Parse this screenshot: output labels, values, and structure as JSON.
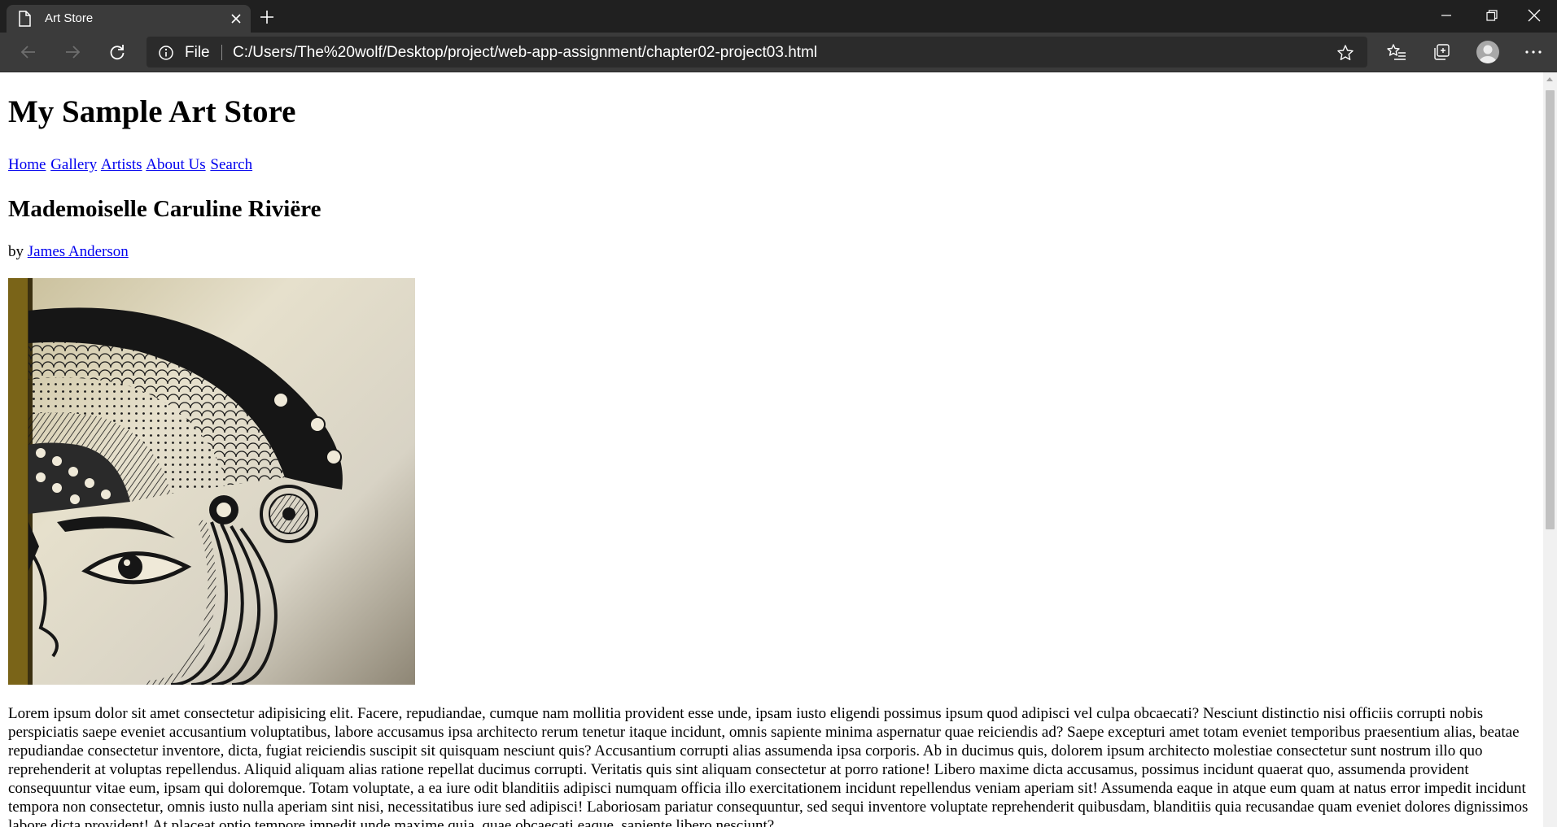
{
  "browser": {
    "tab_title": "Art Store",
    "address_chip": "File",
    "url": "C:/Users/The%20wolf/Desktop/project/web-app-assignment/chapter02-project03.html"
  },
  "page": {
    "site_title": "My Sample Art Store",
    "nav": [
      "Home",
      "Gallery",
      "Artists",
      "About Us",
      "Search"
    ],
    "art_title": "Mademoiselle Caruline Riviëre",
    "by_prefix": "by",
    "artist": "James Anderson",
    "description": "Lorem ipsum dolor sit amet consectetur adipisicing elit. Facere, repudiandae, cumque nam mollitia provident esse unde, ipsam iusto eligendi possimus ipsum quod adipisci vel culpa obcaecati? Nesciunt distinctio nisi officiis corrupti nobis perspiciatis saepe eveniet accusantium voluptatibus, labore accusamus ipsa architecto rerum tenetur itaque incidunt, omnis sapiente minima aspernatur quae reiciendis ad? Saepe excepturi amet totam eveniet temporibus praesentium alias, beatae repudiandae consectetur inventore, dicta, fugiat reiciendis suscipit sit quisquam nesciunt quis? Accusantium corrupti alias assumenda ipsa corporis. Ab in ducimus quis, dolorem ipsum architecto molestiae consectetur sunt nostrum illo quo reprehenderit at voluptas repellendus. Aliquid aliquam alias ratione repellat ducimus corrupti. Veritatis quis sint aliquam consectetur at porro ratione! Libero maxime dicta accusamus, possimus incidunt quaerat quo, assumenda provident consequuntur vitae eum, ipsam qui doloremque. Totam voluptate, a ea iure odit blanditiis adipisci numquam officia illo exercitationem incidunt repellendus veniam aperiam sit! Assumenda eaque in atque eum quam at natus error impedit incidunt tempora non consectetur, omnis iusto nulla aperiam sint nisi, necessitatibus iure sed adipisci! Laboriosam pariatur consequuntur, sed sequi inventore voluptate reprehenderit quibusdam, blanditiis quia recusandae quam eveniet dolores dignissimos labore dicta provident! At placeat optio tempore impedit unde maxime quia, quae obcaecati eaque, sapiente libero nesciunt?"
  },
  "colors": {
    "link": "#0000ee",
    "titlebar": "#202020",
    "toolbar": "#3b3b3b"
  },
  "icons": {
    "tab": "page-icon",
    "tab_close": "close-icon",
    "new_tab": "plus-icon",
    "back": "back-arrow-icon",
    "forward": "forward-arrow-icon",
    "refresh": "refresh-icon",
    "site_info": "info-icon",
    "favorite": "star-icon",
    "favorites": "favorites-list-icon",
    "collections": "collections-icon",
    "profile": "profile-avatar",
    "menu": "more-icon"
  }
}
